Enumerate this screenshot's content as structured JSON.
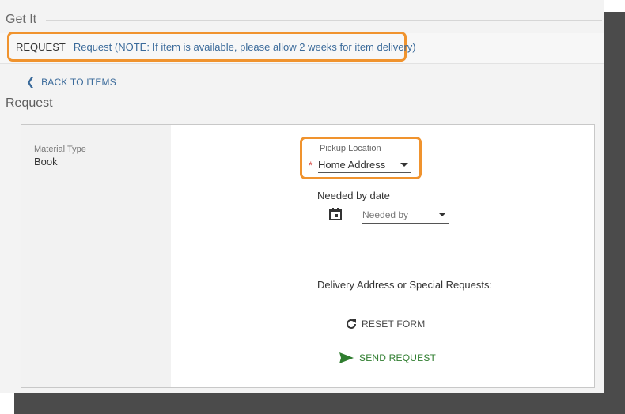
{
  "section": {
    "title": "Get It"
  },
  "request_bar": {
    "label": "REQUEST",
    "link_text": "Request (NOTE: If item is available, please allow 2 weeks for item delivery)"
  },
  "back": {
    "label": "BACK TO ITEMS",
    "icon": "chevron-left-icon"
  },
  "form": {
    "title": "Request",
    "material": {
      "label": "Material Type",
      "value": "Book"
    },
    "pickup": {
      "label": "Pickup Location",
      "value": "Home Address",
      "required_mark": "*"
    },
    "needed": {
      "title": "Needed by date",
      "placeholder": "Needed by"
    },
    "delivery": {
      "label": "Delivery Address or Special Requests:"
    },
    "reset_label": "RESET FORM",
    "send_label": "SEND REQUEST"
  },
  "colors": {
    "highlight": "#f0932e",
    "link": "#3a6a9a",
    "send": "#2f7d2f",
    "required": "#d9534f"
  }
}
